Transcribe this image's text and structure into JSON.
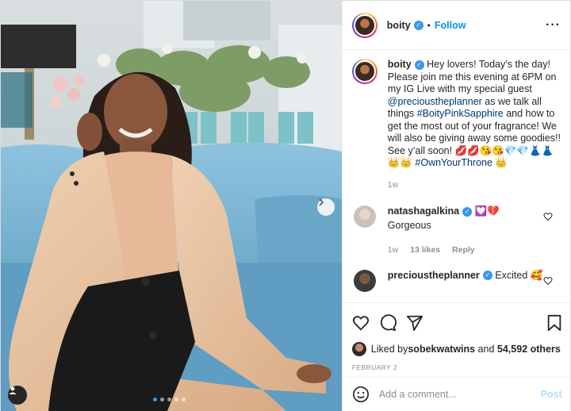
{
  "author": {
    "username": "boity",
    "follow_label": "Follow",
    "dot": "•"
  },
  "caption": {
    "username": "boity",
    "text_1": " Hey lovers! Today’s the day! Please join me this evening at 6PM on my IG Live with my special guest ",
    "mention": "@precioustheplanner",
    "text_2": " as we talk all things ",
    "hashtag_1": "#BoityPinkSapphire",
    "text_3": " and how to get the most out of your fragrance! We will also be giving away some goodies!! See y’all soon! ",
    "emoji_line": "💋💋😘😘💎💎👗👗👑👑 ",
    "hashtag_2": "#OwnYourThrone",
    "emoji_end": " 👑",
    "age": "1w"
  },
  "comments": [
    {
      "username": "natashagalkina",
      "emoji": "💟💔",
      "text": "Gorgeous",
      "age": "1w",
      "likes": "13 likes",
      "reply": "Reply"
    },
    {
      "username": "precioustheplanner",
      "text": "Excited 🥰"
    }
  ],
  "likes": {
    "liked_by": "Liked by ",
    "user": "sobekwatwins",
    "and": " and ",
    "count": "54,592 others"
  },
  "date": "FEBRUARY 2",
  "add_comment": {
    "placeholder": "Add a comment...",
    "post_label": "Post"
  },
  "colors": {
    "accent": "#0095f6",
    "verified": "#3897f0",
    "post_disabled": "#b2dffc",
    "sofa": "#7fb6d6",
    "blazer": "#e6bf9c"
  },
  "icons": [
    "more-icon",
    "verified-icon",
    "next-icon",
    "tag-user-icon",
    "like-icon",
    "comment-icon",
    "share-icon",
    "save-icon",
    "emoji-icon",
    "heart-icon"
  ],
  "carousel": {
    "count": 5,
    "active": 1
  }
}
